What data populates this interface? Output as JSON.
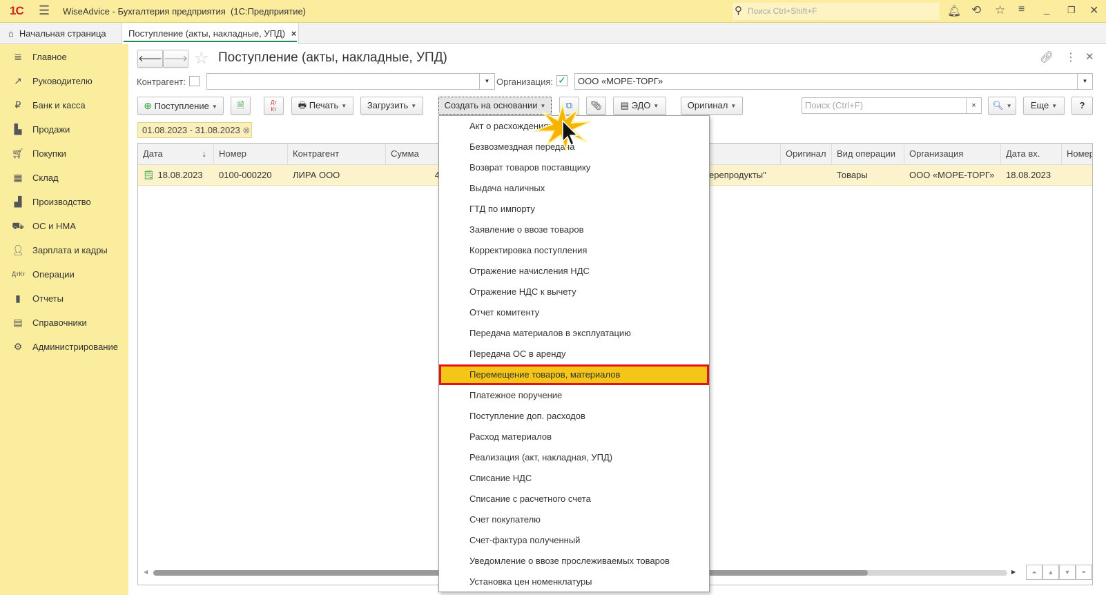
{
  "titlebar": {
    "app_title": "WiseAdvice - Бухгалтерия предприятия  (1С:Предприятие)",
    "search_placeholder": "Поиск Ctrl+Shift+F"
  },
  "tabs": [
    {
      "label": "Начальная страница"
    },
    {
      "label": "Поступление (акты, накладные, УПД)"
    }
  ],
  "sidebar": {
    "items": [
      {
        "label": "Главное"
      },
      {
        "label": "Руководителю"
      },
      {
        "label": "Банк и касса"
      },
      {
        "label": "Продажи"
      },
      {
        "label": "Покупки"
      },
      {
        "label": "Склад"
      },
      {
        "label": "Производство"
      },
      {
        "label": "ОС и НМА"
      },
      {
        "label": "Зарплата и кадры"
      },
      {
        "label": "Операции"
      },
      {
        "label": "Отчеты"
      },
      {
        "label": "Справочники"
      },
      {
        "label": "Администрирование"
      }
    ]
  },
  "form": {
    "title": "Поступление (акты, накладные, УПД)",
    "filters": {
      "counterparty_label": "Контрагент:",
      "counterparty_value": "",
      "org_label": "Организация:",
      "org_value": "ООО «МОРЕ-ТОРГ»"
    },
    "toolbar": {
      "receipt": "Поступление",
      "print": "Печать",
      "load": "Загрузить",
      "create_based": "Создать на основании",
      "edo": "ЭДО",
      "original": "Оригинал",
      "search_placeholder": "Поиск (Ctrl+F)",
      "more": "Еще",
      "help": "?",
      "dtkt_top": "Дт",
      "dtkt_bottom": "Кт"
    },
    "period": "01.08.2023 - 31.08.2023"
  },
  "table": {
    "columns": [
      "Дата",
      "Номер",
      "Контрагент",
      "Сумма",
      "",
      "Оригинал",
      "Вид операции",
      "Организация",
      "Дата вх.",
      "Номер"
    ],
    "rows": [
      {
        "date": "18.08.2023",
        "number": "0100-000220",
        "counterparty": "ЛИРА ООО",
        "sum": "42 0",
        "hidden": "ерепродукты\"",
        "original": "",
        "operation": "Товары",
        "org": "ООО «МОРЕ-ТОРГ»",
        "in_date": "18.08.2023",
        "in_number": ""
      }
    ]
  },
  "menu": {
    "items": [
      "Акт о расхождениях",
      "Безвозмездная передача",
      "Возврат товаров поставщику",
      "Выдача наличных",
      "ГТД по импорту",
      "Заявление о ввозе товаров",
      "Корректировка поступления",
      "Отражение начисления НДС",
      "Отражение НДС к вычету",
      "Отчет комитенту",
      "Передача материалов в эксплуатацию",
      "Передача ОС в аренду",
      "Перемещение товаров, материалов",
      "Платежное поручение",
      "Поступление доп. расходов",
      "Расход материалов",
      "Реализация (акт, накладная, УПД)",
      "Списание НДС",
      "Списание с расчетного счета",
      "Счет покупателю",
      "Счет-фактура полученный",
      "Уведомление о ввозе прослеживаемых товаров",
      "Установка цен номенклатуры"
    ],
    "selected_index": 12
  },
  "colors": {
    "accent": "#fbec9e",
    "highlight": "#f5c518",
    "highlight_border": "#e0141a",
    "row": "#fcf3cc"
  }
}
